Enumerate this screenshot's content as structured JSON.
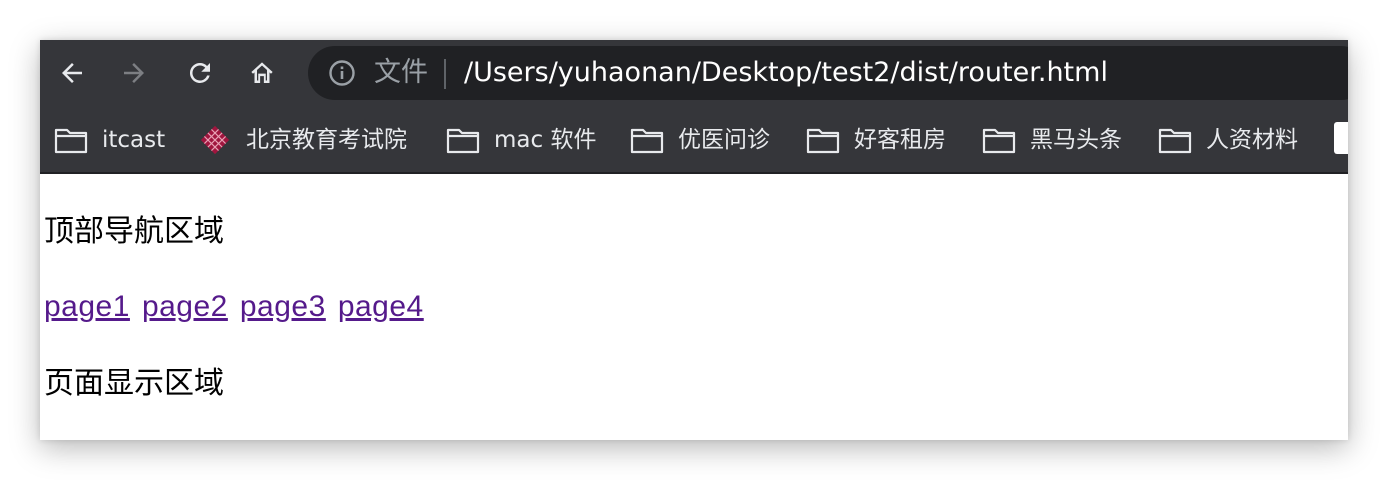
{
  "toolbar": {
    "back_icon": "arrow-left-icon",
    "forward_icon": "arrow-right-icon",
    "reload_icon": "reload-icon",
    "home_icon": "home-icon"
  },
  "omnibox": {
    "info_icon": "info-icon",
    "scheme_label": "文件",
    "url": "/Users/yuhaonan/Desktop/test2/dist/router.html"
  },
  "bookmarks": {
    "items": [
      {
        "label": "itcast",
        "icon": "folder-icon"
      },
      {
        "label": "北京教育考试院",
        "icon": "site-favicon"
      },
      {
        "label": "mac 软件",
        "icon": "folder-icon"
      },
      {
        "label": "优医问诊",
        "icon": "folder-icon"
      },
      {
        "label": "好客租房",
        "icon": "folder-icon"
      },
      {
        "label": "黑马头条",
        "icon": "folder-icon"
      },
      {
        "label": "人资材料",
        "icon": "folder-icon"
      }
    ]
  },
  "page": {
    "top_nav_text": "顶部导航区域",
    "links": [
      "page1",
      "page2",
      "page3",
      "page4"
    ],
    "display_text": "页面显示区域"
  },
  "colors": {
    "toolbar_bg": "#35363a",
    "omnibox_bg": "#202124",
    "visited_link": "#551a8b"
  }
}
